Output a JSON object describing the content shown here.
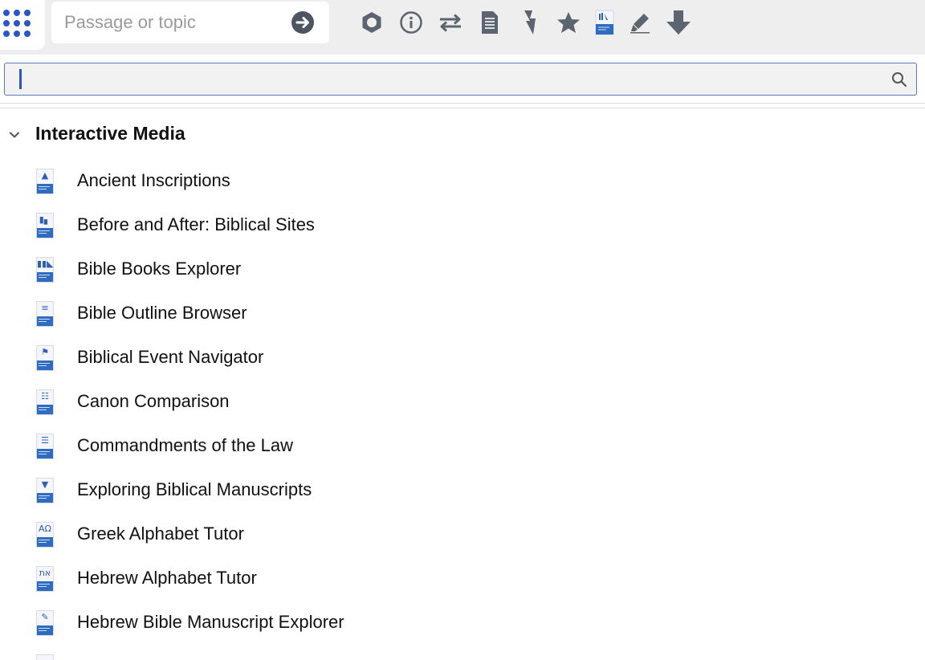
{
  "toolbar": {
    "passage_placeholder": "Passage or topic",
    "icons": [
      "apps-grid-icon",
      "arrow-right-circle-icon",
      "hexagon-icon",
      "info-icon",
      "swap-arrows-icon",
      "document-list-icon",
      "lightning-icon",
      "star-icon",
      "bible-books-icon",
      "highlighter-icon",
      "arrow-down-icon"
    ]
  },
  "search": {
    "value": "",
    "placeholder": ""
  },
  "section": {
    "title": "Interactive Media",
    "expanded": true
  },
  "items": [
    {
      "label": "Ancient Inscriptions",
      "icon": "inscription-thumb-icon"
    },
    {
      "label": "Before and After: Biblical Sites",
      "icon": "sites-thumb-icon"
    },
    {
      "label": "Bible Books Explorer",
      "icon": "books-thumb-icon"
    },
    {
      "label": "Bible Outline Browser",
      "icon": "outline-thumb-icon"
    },
    {
      "label": "Biblical Event Navigator",
      "icon": "flag-thumb-icon"
    },
    {
      "label": "Canon Comparison",
      "icon": "canon-thumb-icon"
    },
    {
      "label": "Commandments of the Law",
      "icon": "scroll-thumb-icon"
    },
    {
      "label": "Exploring Biblical Manuscripts",
      "icon": "manuscript-thumb-icon"
    },
    {
      "label": "Greek Alphabet Tutor",
      "icon": "greek-thumb-icon"
    },
    {
      "label": "Hebrew Alphabet Tutor",
      "icon": "hebrew-thumb-icon"
    },
    {
      "label": "Hebrew Bible Manuscript Explorer",
      "icon": "quill-thumb-icon"
    }
  ],
  "colors": {
    "accent": "#2a55c4",
    "toolbar_bg": "#eeeeee",
    "icon_gray": "#5c6470",
    "thumb_blue": "#2f6cbf"
  }
}
